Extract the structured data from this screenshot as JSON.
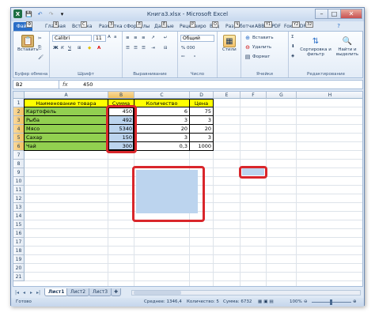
{
  "window": {
    "title": "Книга3.xlsx - Microsoft Excel"
  },
  "quick_access": {
    "icons": [
      "excel-logo-icon",
      "save-icon",
      "undo-icon",
      "redo-icon",
      "customize-icon"
    ]
  },
  "tabs": [
    {
      "label": "Файл",
      "key": "Ф"
    },
    {
      "label": "Главная",
      "key": "Я"
    },
    {
      "label": "Вставка",
      "key": "С"
    },
    {
      "label": "Разметка с",
      "key": "З"
    },
    {
      "label": "Формулы",
      "key": "Л"
    },
    {
      "label": "Данные",
      "key": "Ё"
    },
    {
      "label": "Рецензиро",
      "key": "Р"
    },
    {
      "label": "Вид",
      "key": "О"
    },
    {
      "label": "Разработчи",
      "key": "Ч"
    },
    {
      "label": "ABBYY PDF",
      "key": "Y1"
    },
    {
      "label": "Foxit PDF",
      "key": "Y2"
    },
    {
      "label": "",
      "key": "32"
    }
  ],
  "ribbon": {
    "clipboard": {
      "paste": "Вставить",
      "label": "Буфер обмена"
    },
    "font": {
      "name": "Calibri",
      "size": "11",
      "label": "Шрифт"
    },
    "alignment": {
      "label": "Выравнивание"
    },
    "number": {
      "format": "Общий",
      "currency": "% 000",
      "label": "Число"
    },
    "styles": {
      "button": "Стили"
    },
    "cells": {
      "insert": "Вставить",
      "delete": "Удалить",
      "format": "Формат",
      "label": "Ячейки"
    },
    "editing": {
      "sort": "Сортировка и фильтр",
      "find": "Найти и выделить",
      "label": "Редактирование"
    }
  },
  "formula_bar": {
    "name_box": "B2",
    "fx": "fx",
    "value": "450"
  },
  "columns": [
    "A",
    "B",
    "C",
    "D",
    "E",
    "F",
    "G",
    "H"
  ],
  "rows": [
    "1",
    "2",
    "3",
    "4",
    "5",
    "6",
    "7",
    "8",
    "9",
    "10",
    "11",
    "12",
    "13",
    "14",
    "15",
    "16",
    "17",
    "18",
    "19",
    "20",
    "21"
  ],
  "table": {
    "headers": [
      "Наименование товара",
      "Сумма",
      "Количество",
      "Цена"
    ],
    "rows": [
      [
        "Картофель",
        "450",
        "6",
        "75"
      ],
      [
        "Рыба",
        "492",
        "3",
        "3"
      ],
      [
        "Мясо",
        "5340",
        "20",
        "20"
      ],
      [
        "Сахар",
        "150",
        "3",
        "3"
      ],
      [
        "Чай",
        "300",
        "0,3",
        "1000"
      ]
    ]
  },
  "sheets": [
    "Лист1",
    "Лист2",
    "Лист3"
  ],
  "status": {
    "ready": "Готово",
    "average": "Среднее: 1346,4",
    "count": "Количество: 5",
    "sum": "Сумма: 6732",
    "zoom": "100%"
  },
  "colors": {
    "green_fill": "#92d050",
    "yellow_fill": "#ffff00",
    "selection_fill": "#bcd4ee",
    "highlight_border": "#d9262b"
  }
}
